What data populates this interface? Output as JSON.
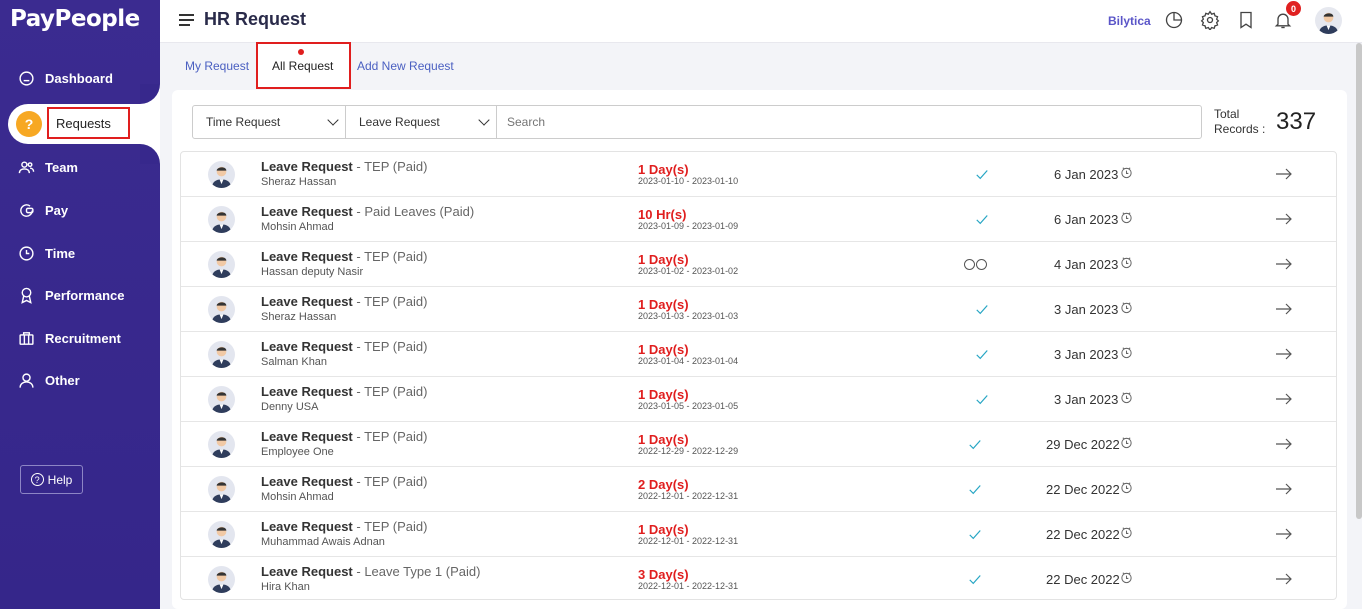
{
  "app": {
    "logo": "PayPeople",
    "page_title": "HR Request",
    "brand_link": "Bilytica",
    "notification_count": "0"
  },
  "sidebar": {
    "items": [
      {
        "label": "Dashboard",
        "icon": "dashboard-icon"
      },
      {
        "label": "Requests",
        "icon": "requests-icon",
        "active": true
      },
      {
        "label": "Team",
        "icon": "team-icon"
      },
      {
        "label": "Pay",
        "icon": "pay-icon"
      },
      {
        "label": "Time",
        "icon": "clock-icon"
      },
      {
        "label": "Performance",
        "icon": "award-icon"
      },
      {
        "label": "Recruitment",
        "icon": "briefcase-icon"
      },
      {
        "label": "Other",
        "icon": "user-icon"
      }
    ],
    "help_label": "Help",
    "requests_glyph": "?"
  },
  "tabs": [
    {
      "label": "My Request"
    },
    {
      "label": "All Request",
      "active": true
    },
    {
      "label": "Add New Request"
    }
  ],
  "filters": {
    "time_request": "Time Request",
    "leave_request": "Leave Request",
    "search_placeholder": "Search",
    "total_label_1": "Total",
    "total_label_2": "Records :",
    "total_value": "337"
  },
  "rows": [
    {
      "title": "Leave Request",
      "type": " - TEP (Paid)",
      "name": "Sheraz Hassan",
      "duration": "1 Day(s)",
      "range": "2023-01-10 - 2023-01-10",
      "status": "approved",
      "date": "6 Jan 2023"
    },
    {
      "title": "Leave Request",
      "type": " - Paid Leaves (Paid)",
      "name": "Mohsin Ahmad",
      "duration": "10 Hr(s)",
      "range": "2023-01-09 - 2023-01-09",
      "status": "approved",
      "date": "6 Jan 2023"
    },
    {
      "title": "Leave Request",
      "type": " - TEP (Paid)",
      "name": "Hassan deputy Nasir",
      "duration": "1 Day(s)",
      "range": "2023-01-02 - 2023-01-02",
      "status": "pending",
      "date": "4 Jan 2023"
    },
    {
      "title": "Leave Request",
      "type": " - TEP (Paid)",
      "name": "Sheraz Hassan",
      "duration": "1 Day(s)",
      "range": "2023-01-03 - 2023-01-03",
      "status": "approved",
      "date": "3 Jan 2023"
    },
    {
      "title": "Leave Request",
      "type": " - TEP (Paid)",
      "name": "Salman Khan",
      "duration": "1 Day(s)",
      "range": "2023-01-04 - 2023-01-04",
      "status": "approved",
      "date": "3 Jan 2023"
    },
    {
      "title": "Leave Request",
      "type": " - TEP (Paid)",
      "name": "Denny USA",
      "duration": "1 Day(s)",
      "range": "2023-01-05 - 2023-01-05",
      "status": "approved",
      "date": "3 Jan 2023"
    },
    {
      "title": "Leave Request",
      "type": " - TEP (Paid)",
      "name": "Employee One",
      "duration": "1 Day(s)",
      "range": "2022-12-29 - 2022-12-29",
      "status": "approved",
      "date": "29 Dec 2022"
    },
    {
      "title": "Leave Request",
      "type": " - TEP (Paid)",
      "name": "Mohsin Ahmad",
      "duration": "2 Day(s)",
      "range": "2022-12-01 - 2022-12-31",
      "status": "approved",
      "date": "22 Dec 2022"
    },
    {
      "title": "Leave Request",
      "type": " - TEP (Paid)",
      "name": "Muhammad Awais Adnan",
      "duration": "1 Day(s)",
      "range": "2022-12-01 - 2022-12-31",
      "status": "approved",
      "date": "22 Dec 2022"
    },
    {
      "title": "Leave Request",
      "type": " - Leave Type 1 (Paid)",
      "name": "Hira Khan",
      "duration": "3 Day(s)",
      "range": "2022-12-01 - 2022-12-31",
      "status": "approved",
      "date": "22 Dec 2022"
    }
  ]
}
